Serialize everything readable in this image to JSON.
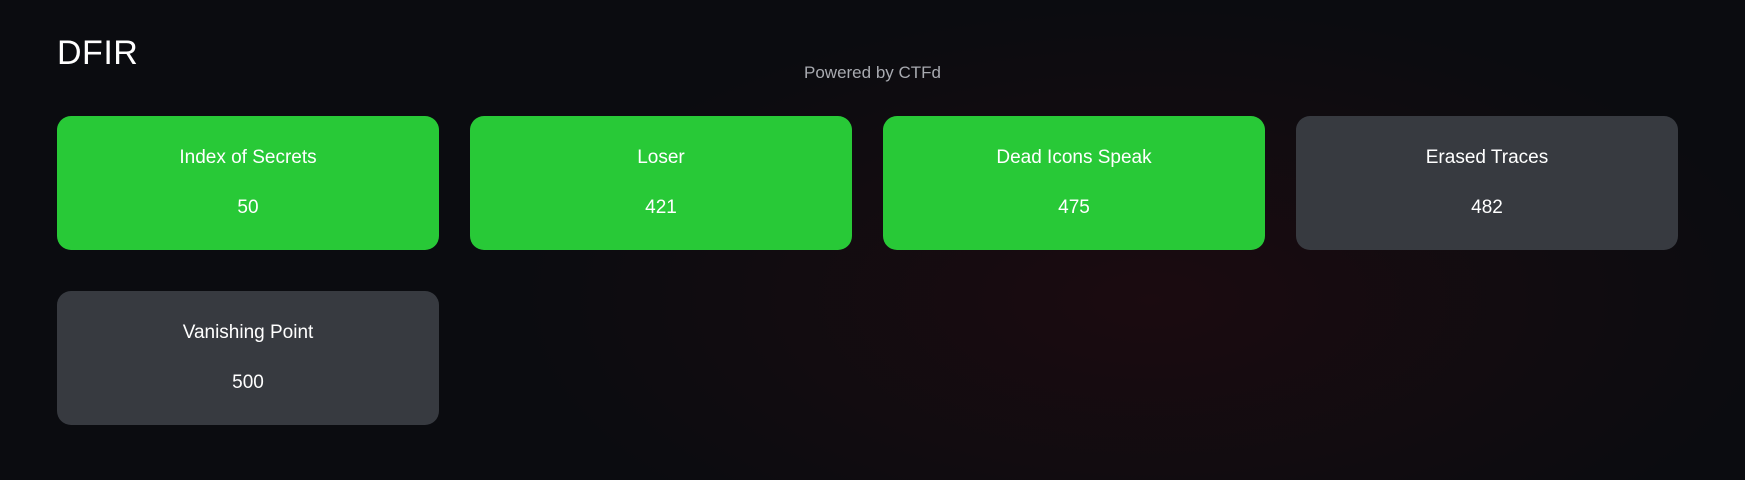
{
  "category": {
    "title": "DFIR"
  },
  "footer": {
    "powered_by": "Powered by CTFd"
  },
  "colors": {
    "solved": "#28c937",
    "unsolved": "#373a40",
    "background": "#0b0c10"
  },
  "challenges": [
    {
      "name": "Index of Secrets",
      "points": "50",
      "solved": true
    },
    {
      "name": "Loser",
      "points": "421",
      "solved": true
    },
    {
      "name": "Dead Icons Speak",
      "points": "475",
      "solved": true
    },
    {
      "name": "Erased Traces",
      "points": "482",
      "solved": false
    },
    {
      "name": "Vanishing Point",
      "points": "500",
      "solved": false
    }
  ]
}
